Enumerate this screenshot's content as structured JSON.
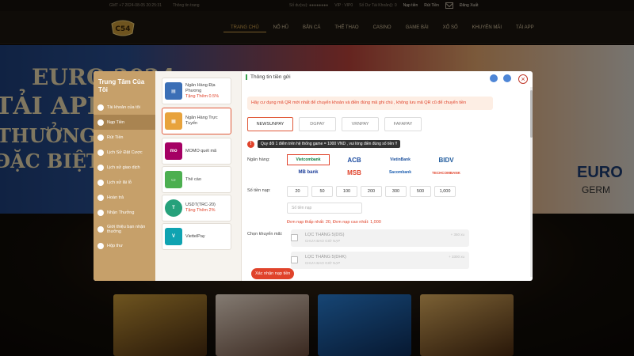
{
  "topbar": {
    "time": "GMT +7   2024-08-05 20:25:31",
    "notice": "Thông tin trang",
    "balance_label": "Số dư(xu): ●●●●●●●●",
    "vip": "VIP : VIP0",
    "bonus": "Số Dư Tài Khoản(): 0",
    "deposit": "Nạp tiền",
    "withdraw": "Rút Tiền",
    "logout": "Đăng Xuất"
  },
  "logo": {
    "text": "C54"
  },
  "nav": [
    "TRANG CHỦ",
    "NỔ HŨ",
    "BẮN CÁ",
    "THỂ THAO",
    "CASINO",
    "GAME BÀI",
    "XỔ SỐ",
    "KHUYẾN MÃI",
    "TẢI APP"
  ],
  "banner": {
    "line1": "EURO 2024",
    "line2": "TẢI APP",
    "line3": "THƯỞNG",
    "line4": "ĐẶC BIỆT",
    "right": "EURO",
    "right2": "GERM"
  },
  "sidebar": {
    "title": "Trung Tâm Của Tôi",
    "items": [
      {
        "label": "Tài khoản của tôi"
      },
      {
        "label": "Nạp Tiền"
      },
      {
        "label": "Rút Tiền"
      },
      {
        "label": "Lịch Sử Đặt Cược"
      },
      {
        "label": "Lịch sử giao dịch"
      },
      {
        "label": "Lịch sử lãi lỗ"
      },
      {
        "label": "Hoàn trả"
      },
      {
        "label": "Nhận Thưởng"
      },
      {
        "label": "Giới thiệu bạn nhận thưởng"
      },
      {
        "label": "Hộp thư"
      }
    ]
  },
  "methods": [
    {
      "name": "Ngân Hàng Địa Phương",
      "promo": "Tặng Thêm 0.5%",
      "icon": "bank-icon",
      "color": "#3b6fb6"
    },
    {
      "name": "Ngân Hàng Trực Tuyến",
      "promo": "",
      "icon": "online-bank-icon",
      "color": "#e8a33c"
    },
    {
      "name": "MOMO quét mã",
      "promo": "",
      "icon": "momo-icon",
      "color": "#a50064"
    },
    {
      "name": "Thẻ cào",
      "promo": "",
      "icon": "card-icon",
      "color": "#4caf50"
    },
    {
      "name": "USDT(TRC-20)",
      "promo": "Tặng Thêm 2%",
      "icon": "usdt-icon",
      "color": "#26a17b"
    },
    {
      "name": "ViettelPay",
      "promo": "",
      "icon": "viettelpay-icon",
      "color": "#0fa3b1"
    }
  ],
  "panel": {
    "title": "Thông tin tiền gửi",
    "notice": "Hãy cư dụng mã QR mới nhất để chuyển khoản và điền đúng mã ghi chú , không lưu mã QR cũ để chuyển tiền",
    "tabs": [
      "NEWSUNPAY",
      "DGPAY",
      "VRNPAY",
      "FAFAPAY"
    ],
    "warning": "Quy đổi 1 điểm trên hệ thống game = 1000 VND , vui lòng điền đúng số tiền !!",
    "bank_label": "Ngân hàng:",
    "banks": [
      {
        "name": "Vietcombank",
        "color": "#0a7c3e"
      },
      {
        "name": "ACB",
        "color": "#1f4ea1"
      },
      {
        "name": "VietinBank",
        "color": "#1b4f9c"
      },
      {
        "name": "BIDV",
        "color": "#1e5a9c"
      },
      {
        "name": "MB bank",
        "color": "#1e3f9a"
      },
      {
        "name": "MSB",
        "color": "#e0432b"
      },
      {
        "name": "Sacombank",
        "color": "#1d5fb0"
      },
      {
        "name": "TECHCOMBANK",
        "color": "#e0432b"
      }
    ],
    "amount_label": "Số tiền nạp:",
    "amounts": [
      "20",
      "50",
      "100",
      "200",
      "300",
      "500",
      "1,000"
    ],
    "amount_placeholder": "Số tiền nạp",
    "limits": "Đơn nạp thấp nhất:  20,   Đơn nạp cao nhất:  1,000",
    "promo_label": "Chọn khuyến mãi:",
    "promos": [
      {
        "title": "LỌC THÁNG 5(DIS)",
        "sub": "CHƯA BAO GIỜ NẠP",
        "value": "+ 350 xu"
      },
      {
        "title": "LỌC THÁNG 5(DHK)",
        "sub": "CHƯA BAO GIỜ NẠP",
        "value": "+ 3300 xu"
      }
    ],
    "submit": "Xác nhận nạp tiền"
  }
}
